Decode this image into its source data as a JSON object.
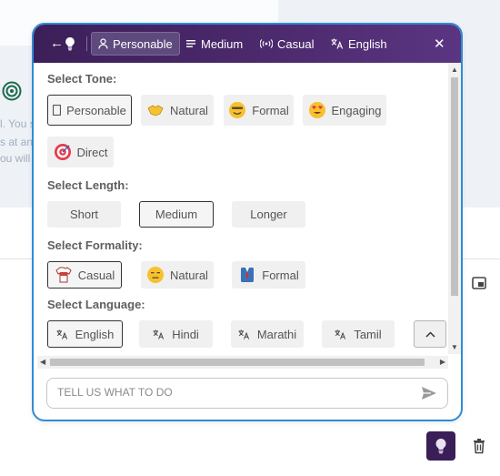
{
  "background": {
    "snippets": [
      "l. You s",
      "s at an",
      "ou will"
    ]
  },
  "toolbar": {
    "items": [
      {
        "label": "Personable",
        "icon": "person-icon"
      },
      {
        "label": "Medium",
        "icon": "lines-icon"
      },
      {
        "label": "Casual",
        "icon": "broadcast-icon"
      },
      {
        "label": "English",
        "icon": "translate-icon"
      }
    ],
    "close": "✕",
    "back": "←"
  },
  "sections": {
    "tone": {
      "label": "Select Tone:",
      "options": [
        "Personable",
        "Natural",
        "Formal",
        "Engaging",
        "Direct"
      ],
      "selected": "Personable"
    },
    "length": {
      "label": "Select Length:",
      "options": [
        "Short",
        "Medium",
        "Longer"
      ],
      "selected": "Medium"
    },
    "formality": {
      "label": "Select Formality:",
      "options": [
        "Casual",
        "Natural",
        "Formal"
      ],
      "selected": "Casual"
    },
    "language": {
      "label": "Select Language:",
      "options": [
        "English",
        "Hindi",
        "Marathi",
        "Tamil"
      ],
      "selected": "English"
    }
  },
  "prompt": {
    "placeholder": "TELL US WHAT TO DO"
  },
  "colors": {
    "header_start": "#3c1f59",
    "header_end": "#5a3582",
    "border": "#2f8cd6",
    "chip_bg": "#f0f0f0"
  }
}
